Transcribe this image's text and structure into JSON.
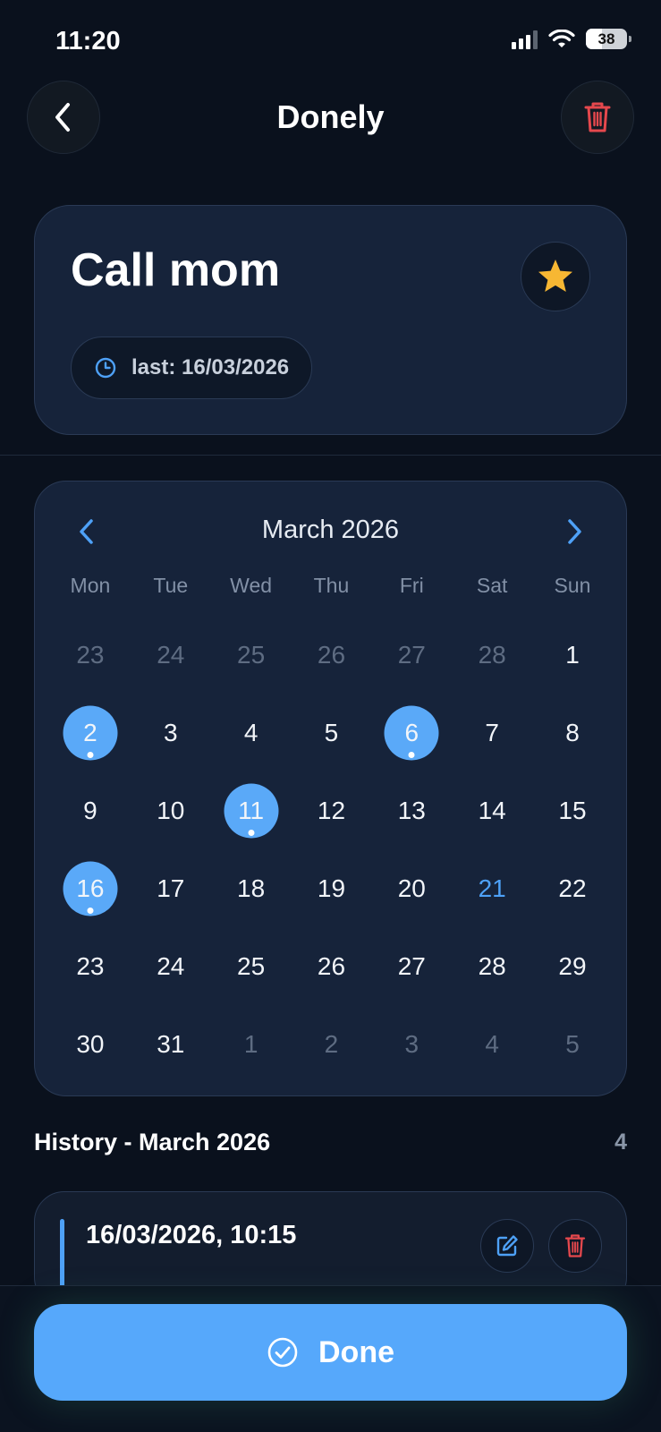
{
  "status_bar": {
    "time": "11:20",
    "battery": "38"
  },
  "header": {
    "title": "Donely"
  },
  "task": {
    "name": "Call mom",
    "last_label": "last: 16/03/2026"
  },
  "calendar": {
    "month_label": "March 2026",
    "weekdays": [
      "Mon",
      "Tue",
      "Wed",
      "Thu",
      "Fri",
      "Sat",
      "Sun"
    ],
    "days": [
      {
        "n": "23",
        "muted": true
      },
      {
        "n": "24",
        "muted": true
      },
      {
        "n": "25",
        "muted": true
      },
      {
        "n": "26",
        "muted": true
      },
      {
        "n": "27",
        "muted": true
      },
      {
        "n": "28",
        "muted": true
      },
      {
        "n": "1"
      },
      {
        "n": "2",
        "done": true
      },
      {
        "n": "3"
      },
      {
        "n": "4"
      },
      {
        "n": "5"
      },
      {
        "n": "6",
        "done": true
      },
      {
        "n": "7"
      },
      {
        "n": "8"
      },
      {
        "n": "9"
      },
      {
        "n": "10"
      },
      {
        "n": "11",
        "done": true
      },
      {
        "n": "12"
      },
      {
        "n": "13"
      },
      {
        "n": "14"
      },
      {
        "n": "15"
      },
      {
        "n": "16",
        "done": true
      },
      {
        "n": "17"
      },
      {
        "n": "18"
      },
      {
        "n": "19"
      },
      {
        "n": "20"
      },
      {
        "n": "21",
        "today": true
      },
      {
        "n": "22"
      },
      {
        "n": "23"
      },
      {
        "n": "24"
      },
      {
        "n": "25"
      },
      {
        "n": "26"
      },
      {
        "n": "27"
      },
      {
        "n": "28"
      },
      {
        "n": "29"
      },
      {
        "n": "30"
      },
      {
        "n": "31"
      },
      {
        "n": "1",
        "muted": true
      },
      {
        "n": "2",
        "muted": true
      },
      {
        "n": "3",
        "muted": true
      },
      {
        "n": "4",
        "muted": true
      },
      {
        "n": "5",
        "muted": true
      }
    ]
  },
  "history": {
    "title": "History - March 2026",
    "count": "4",
    "items": [
      {
        "datetime": "16/03/2026, 10:15"
      }
    ]
  },
  "done_button": {
    "label": "Done"
  },
  "colors": {
    "accent": "#56a8fb",
    "danger": "#e5484d",
    "star": "#f7b733",
    "background": "#0a111d",
    "card": "#16233a"
  }
}
